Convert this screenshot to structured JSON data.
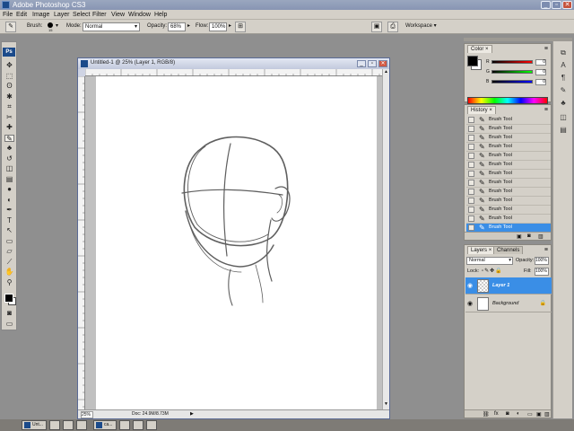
{
  "app": {
    "title": "Adobe Photoshop CS3",
    "window_buttons": [
      "_",
      "▫",
      "✕"
    ]
  },
  "menu": [
    "File",
    "Edit",
    "Image",
    "Layer",
    "Select",
    "Filter",
    "View",
    "Window",
    "Help"
  ],
  "options_bar": {
    "brush_label": "Brush:",
    "brush_size": "15",
    "mode_label": "Mode:",
    "mode_value": "Normal",
    "opacity_label": "Opacity:",
    "opacity_value": "68%",
    "flow_label": "Flow:",
    "flow_value": "100%",
    "workspace_label": "Workspace ▾"
  },
  "toolbox": {
    "logo": "Ps",
    "icons": [
      "move-icon",
      "marquee-icon",
      "lasso-icon",
      "magic-wand-icon",
      "crop-icon",
      "slice-icon",
      "healing-icon",
      "brush-icon",
      "stamp-icon",
      "history-brush-icon",
      "eraser-icon",
      "gradient-icon",
      "blur-icon",
      "dodge-icon",
      "pen-icon",
      "type-icon",
      "path-select-icon",
      "shape-icon",
      "notes-icon",
      "eyedropper-icon",
      "hand-icon",
      "zoom-icon"
    ],
    "glyphs": [
      "✥",
      "⬚",
      "ʘ",
      "✱",
      "⌗",
      "✂",
      "✚",
      "✎",
      "♣",
      "↺",
      "◫",
      "▤",
      "●",
      "◐",
      "✒",
      "T",
      "↖",
      "▭",
      "▱",
      "⟋",
      "✋",
      "⚲"
    ]
  },
  "document": {
    "title": "Untitled-1 @ 25% (Layer 1, RGB/8)",
    "zoom": "25%",
    "doc_info": "Doc: 24.9M/8.73M"
  },
  "color_panel": {
    "tab": "Color",
    "tab_close": "×",
    "channels": [
      {
        "label": "R",
        "value": "0"
      },
      {
        "label": "G",
        "value": "0"
      },
      {
        "label": "B",
        "value": "0"
      }
    ]
  },
  "history_panel": {
    "tab": "History",
    "tab_close": "×",
    "items": [
      "Brush Tool",
      "Brush Tool",
      "Brush Tool",
      "Brush Tool",
      "Brush Tool",
      "Brush Tool",
      "Brush Tool",
      "Brush Tool",
      "Brush Tool",
      "Brush Tool",
      "Brush Tool",
      "Brush Tool",
      "Brush Tool"
    ],
    "active_index": 12
  },
  "layers_panel": {
    "tabs": [
      "Layers",
      "Channels"
    ],
    "tab_close": "×",
    "blend_mode": "Normal",
    "opacity_label": "Opacity:",
    "opacity_value": "100%",
    "lock_label": "Lock:",
    "fill_label": "Fill:",
    "fill_value": "100%",
    "layers": [
      {
        "name": "Layer 1",
        "active": true
      },
      {
        "name": "Background",
        "active": false
      }
    ]
  },
  "taskbar": {
    "items": [
      "Unt...",
      "ca..."
    ]
  },
  "colors": {
    "selection": "#3a8ee6",
    "panel": "#d4d0c8",
    "workspace": "#8f8f8f"
  }
}
